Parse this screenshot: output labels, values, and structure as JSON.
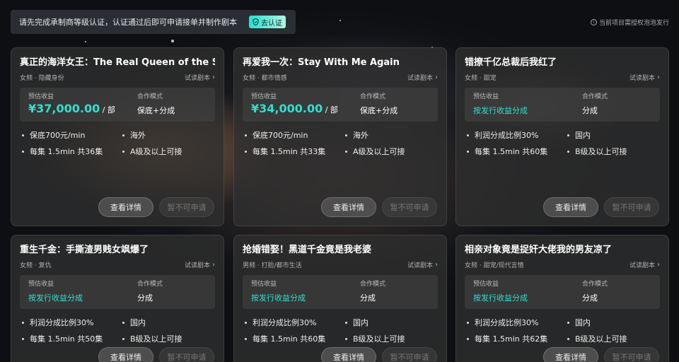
{
  "notice": {
    "text": "请先完成承制商等级认证，认证通过后即可申请接单并制作剧本",
    "button_label": "去认证"
  },
  "auth_note": "当前项目需授权泡泡发行",
  "labels": {
    "income": "预估收益",
    "mode": "合作模式",
    "trial": "试读剧本",
    "detail": "查看详情",
    "apply_disabled": "暂不可申请",
    "per_unit": "/ 部"
  },
  "cards": [
    {
      "title": "真正的海洋女王：The Real Queen of the Sea",
      "genre": "女频 · 隐藏身份",
      "price": "¥37,000.00",
      "income_text": "",
      "mode": "保底+分成",
      "features": [
        "保底700元/min",
        "海外",
        "每集 1.5min 共36集",
        "A级及以上可接"
      ]
    },
    {
      "title": "再爱我一次：Stay With Me Again",
      "genre": "女频 · 都市情感",
      "price": "¥34,000.00",
      "income_text": "",
      "mode": "保底+分成",
      "features": [
        "保底700元/min",
        "海外",
        "每集 1.5min 共33集",
        "A级及以上可接"
      ]
    },
    {
      "title": "错撩千亿总裁后我红了",
      "genre": "女频 · 甜宠",
      "price": "",
      "income_text": "按发行收益分成",
      "mode": "分成",
      "features": [
        "利润分成比例30%",
        "国内",
        "每集 1.5min 共60集",
        "B级及以上可接"
      ]
    },
    {
      "title": "重生千金：手撕渣男贱女飒爆了",
      "genre": "女频 · 复仇",
      "price": "",
      "income_text": "按发行收益分成",
      "mode": "分成",
      "features": [
        "利润分成比例30%",
        "国内",
        "每集 1.5min 共50集",
        "B级及以上可接"
      ]
    },
    {
      "title": "抢婚错娶！黑道千金竟是我老婆",
      "genre": "男频 · 打脸/都市生活",
      "price": "",
      "income_text": "按发行收益分成",
      "mode": "分成",
      "features": [
        "利润分成比例30%",
        "国内",
        "每集 1.5min 共60集",
        "B级及以上可接"
      ]
    },
    {
      "title": "相亲对象竟是捉奸大佬我的男友凉了",
      "genre": "女频 · 甜宠/现代言情",
      "price": "",
      "income_text": "按发行收益分成",
      "mode": "分成",
      "features": [
        "利润分成比例30%",
        "国内",
        "每集 1.5min 共62集",
        "B级及以上可接"
      ]
    }
  ]
}
